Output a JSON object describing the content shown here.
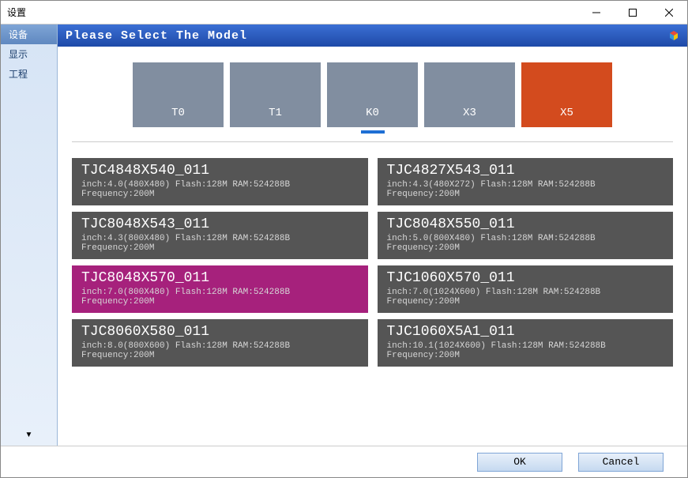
{
  "window": {
    "title": "设置"
  },
  "sidebar": {
    "items": [
      {
        "label": "设备",
        "active": true
      },
      {
        "label": "显示",
        "active": false
      },
      {
        "label": "工程",
        "active": false
      }
    ]
  },
  "header": {
    "title": "Please Select The Model"
  },
  "tabs": [
    {
      "label": "T0",
      "selected": false,
      "indicated": false
    },
    {
      "label": "T1",
      "selected": false,
      "indicated": false
    },
    {
      "label": "K0",
      "selected": false,
      "indicated": true
    },
    {
      "label": "X3",
      "selected": false,
      "indicated": false
    },
    {
      "label": "X5",
      "selected": true,
      "indicated": false
    }
  ],
  "models": [
    {
      "title": "TJC4848X540_011",
      "spec": "inch:4.0(480X480) Flash:128M RAM:524288B Frequency:200M",
      "selected": false
    },
    {
      "title": "TJC4827X543_011",
      "spec": "inch:4.3(480X272) Flash:128M RAM:524288B Frequency:200M",
      "selected": false
    },
    {
      "title": "TJC8048X543_011",
      "spec": "inch:4.3(800X480) Flash:128M RAM:524288B Frequency:200M",
      "selected": false
    },
    {
      "title": "TJC8048X550_011",
      "spec": "inch:5.0(800X480) Flash:128M RAM:524288B Frequency:200M",
      "selected": false
    },
    {
      "title": "TJC8048X570_011",
      "spec": "inch:7.0(800X480) Flash:128M RAM:524288B Frequency:200M",
      "selected": true
    },
    {
      "title": "TJC1060X570_011",
      "spec": "inch:7.0(1024X600) Flash:128M RAM:524288B Frequency:200M",
      "selected": false
    },
    {
      "title": "TJC8060X580_011",
      "spec": "inch:8.0(800X600) Flash:128M RAM:524288B Frequency:200M",
      "selected": false
    },
    {
      "title": "TJC1060X5A1_011",
      "spec": "inch:10.1(1024X600) Flash:128M RAM:524288B Frequency:200M",
      "selected": false
    }
  ],
  "footer": {
    "ok": "OK",
    "cancel": "Cancel"
  }
}
